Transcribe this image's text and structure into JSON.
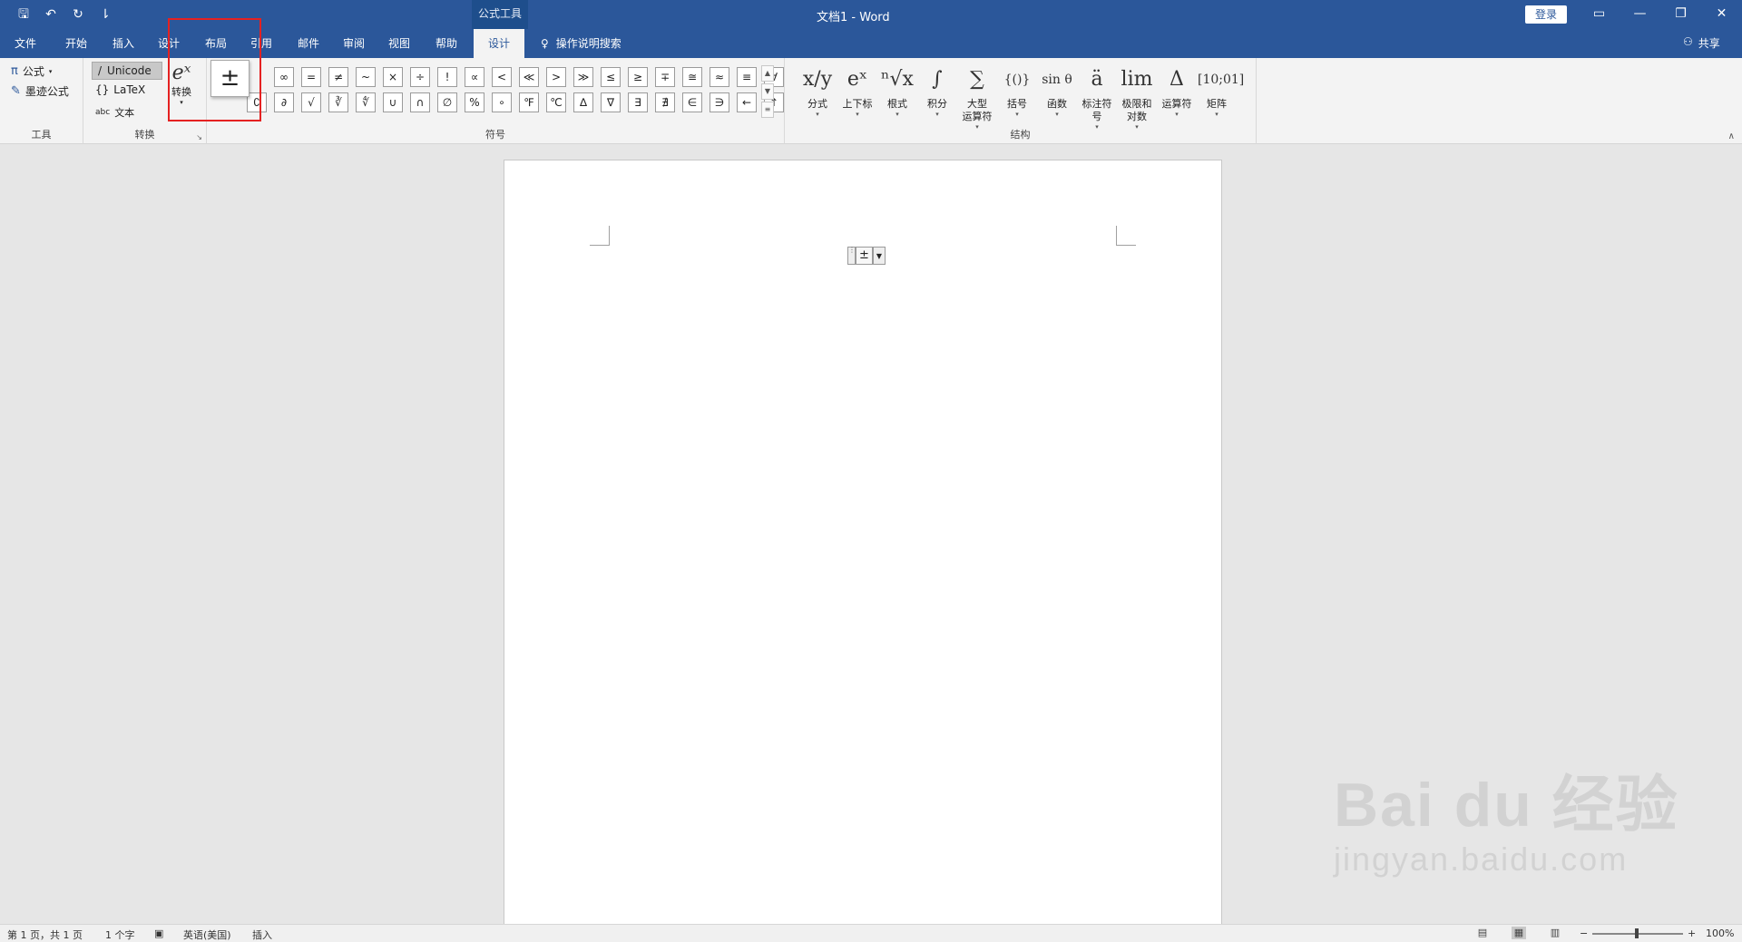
{
  "titlebar": {
    "qat_icons": [
      "save-icon",
      "undo-icon",
      "redo-icon",
      "customize-icon"
    ],
    "qat_glyphs": [
      "🖫",
      "↶",
      "↻",
      "⇂"
    ],
    "context_tools": "公式工具",
    "doc_title": "文档1  -  Word",
    "login": "登录",
    "window_controls": [
      "▭",
      "—",
      "❐",
      "✕"
    ]
  },
  "tabs": {
    "file": "文件",
    "home": "开始",
    "insert": "插入",
    "design": "设计",
    "layout": "布局",
    "references": "引用",
    "mailings": "邮件",
    "review": "审阅",
    "view": "视图",
    "help": "帮助",
    "eq_design": "设计",
    "tellme": "操作说明搜索",
    "share": "共享"
  },
  "ribbon": {
    "tools": {
      "equation": "公式",
      "ink_equation": "墨迹公式",
      "label": "工具"
    },
    "conversions": {
      "unicode": "Unicode",
      "latex": "LaTeX",
      "text": "文本",
      "convert": "转换",
      "label": "转换"
    },
    "popup_symbol": "±",
    "symbols": {
      "label": "符号",
      "row1": [
        "∞",
        "=",
        "≠",
        "~",
        "×",
        "÷",
        "!",
        "∝",
        "<",
        "≪",
        ">",
        "≫",
        "≤",
        "≥",
        "∓",
        "≅",
        "≈",
        "≡",
        "∀"
      ],
      "row2": [
        "∁",
        "∂",
        "√",
        "∛",
        "∜",
        "∪",
        "∩",
        "∅",
        "%",
        "∘",
        "℉",
        "℃",
        "∆",
        "∇",
        "∃",
        "∄",
        "∈",
        "∋",
        "←",
        "↑"
      ]
    },
    "structures": {
      "label": "结构",
      "items": [
        {
          "glyph": "x/y",
          "label": "分式"
        },
        {
          "glyph": "eˣ",
          "label": "上下标"
        },
        {
          "glyph": "ⁿ√x",
          "label": "根式"
        },
        {
          "glyph": "∫",
          "label": "积分"
        },
        {
          "glyph": "∑",
          "label": "大型\n运算符"
        },
        {
          "glyph": "{()}",
          "label": "括号"
        },
        {
          "glyph": "sin θ",
          "label": "函数"
        },
        {
          "glyph": "ä",
          "label": "标注符号"
        },
        {
          "glyph": "lim",
          "label": "极限和对数"
        },
        {
          "glyph": "Δ",
          "label": "运算符"
        },
        {
          "glyph": "[10;01]",
          "label": "矩阵"
        }
      ]
    }
  },
  "document": {
    "equation_content": "±"
  },
  "watermark": {
    "main": "Bai du 经验",
    "sub": "jingyan.baidu.com"
  },
  "statusbar": {
    "page": "第 1 页，共 1 页",
    "words": "1 个字",
    "language": "英语(美国)",
    "mode": "插入",
    "zoom": "100%"
  }
}
